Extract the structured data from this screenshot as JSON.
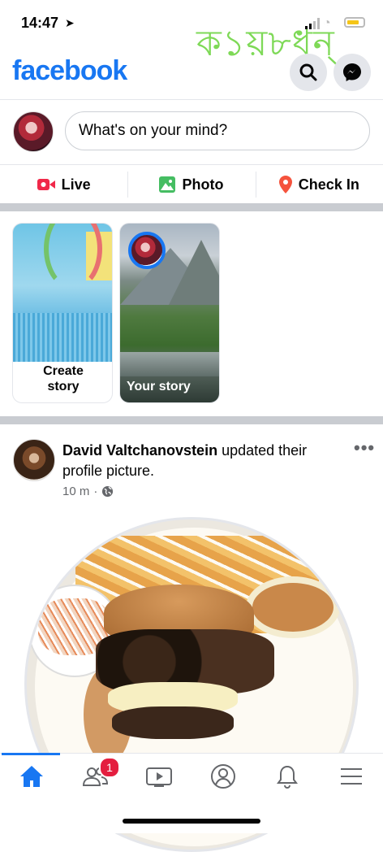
{
  "status_bar": {
    "time": "14:47",
    "watermark": "ক১য়৮ধন্"
  },
  "app": {
    "logo": "facebook",
    "brand_color": "#1877f2"
  },
  "header": {
    "search_icon": "search-icon",
    "messenger_icon": "messenger-icon"
  },
  "composer": {
    "placeholder": "What's on your mind?"
  },
  "actions": {
    "live": "Live",
    "photo": "Photo",
    "check_in": "Check In"
  },
  "stories": {
    "create_line1": "Create",
    "create_line2": "story",
    "your_story": "Your story"
  },
  "post": {
    "author": "David Valtchanovstein",
    "action": " updated their profile picture.",
    "time": "10 m",
    "separator": "·"
  },
  "tabbar": {
    "active": "home",
    "friends_badge": "1"
  }
}
